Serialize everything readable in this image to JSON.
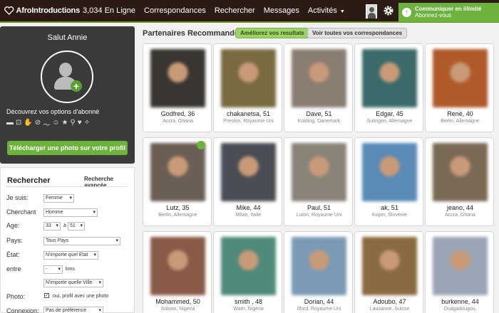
{
  "brand": {
    "name": "AfroIntroductions"
  },
  "nav": {
    "online": "3,034 En Ligne",
    "matches": "Correspondances",
    "search": "Rechercher",
    "messages": "Messages",
    "activities": "Activités"
  },
  "upgrade": {
    "line1": "Communiquer en illimité",
    "line2": "Abonnez-vous"
  },
  "welcome": {
    "greeting": "Salut Annie",
    "options": "Découvrez vos options d'abonné",
    "upload": "Télécharger une photo sur votre profil"
  },
  "search": {
    "title": "Rechercher",
    "advanced": "Recherche avancée",
    "fields": {
      "iam_label": "Je suis:",
      "iam_value": "Femme",
      "seeking_label": "Cherchant",
      "seeking_value": "Homme",
      "age_label": "Age:",
      "age_from": "33",
      "age_to_label": "à",
      "age_to": "51",
      "country_label": "Pays:",
      "country_value": "Tous Pays",
      "state_label": "État:",
      "state_value": "N'importe quel Etat",
      "within_label": "entre",
      "within_value": "-",
      "km": "kms",
      "city_value": "N'importe quelle Ville",
      "photo_label": "Photo:",
      "photo_text": "oui, profil avec une photo",
      "connection_label": "Connexion:",
      "connection_value": "Pas de préférence"
    }
  },
  "recommended": {
    "title": "Partenaires Recommandés",
    "improve": "Améliorez vos resultats",
    "view_all": "Voir toutes vos correspondances"
  },
  "profiles": [
    {
      "name": "Godfred, 36",
      "location": "Accra, Ghana",
      "color": "#3a3530"
    },
    {
      "name": "chakanetsa, 51",
      "location": "Preston, Royaume Uni",
      "color": "#7a6a40"
    },
    {
      "name": "Dave, 51",
      "location": "Kolding, Danemark",
      "color": "#8a7d72"
    },
    {
      "name": "Edgar, 45",
      "location": "Sulingen, Allemagne",
      "color": "#3b6a6a"
    },
    {
      "name": "René, 40",
      "location": "Berlin, Allemagne",
      "color": "#b05a2a"
    },
    {
      "name": "Lutz, 35",
      "location": "Berlin, Allemagne",
      "color": "#6b5e55"
    },
    {
      "name": "Mike, 44",
      "location": "Milan, Italie",
      "color": "#4a4d55"
    },
    {
      "name": "Paul, 51",
      "location": "Luton, Royaume Uni",
      "color": "#8a8478"
    },
    {
      "name": "ak, 51",
      "location": "Koper, Slovénie",
      "color": "#5a8ab5"
    },
    {
      "name": "jeano, 44",
      "location": "Accra, Ghana",
      "color": "#7a6a55"
    },
    {
      "name": "Mohammed, 50",
      "location": "Sokoto, Nigeria",
      "color": "#8a5a48"
    },
    {
      "name": "smith , 48",
      "location": "Warri, Nigeria",
      "color": "#4f8a7a"
    },
    {
      "name": "Dorian, 44",
      "location": "Ilford, Royaume Uni",
      "color": "#7a9ab5"
    },
    {
      "name": "Adoubo, 47",
      "location": "Lausanne, Suisse",
      "color": "#8a6a40"
    },
    {
      "name": "burkenne, 44",
      "location": "Ouagadougou,",
      "color": "#9aa5b5"
    }
  ]
}
